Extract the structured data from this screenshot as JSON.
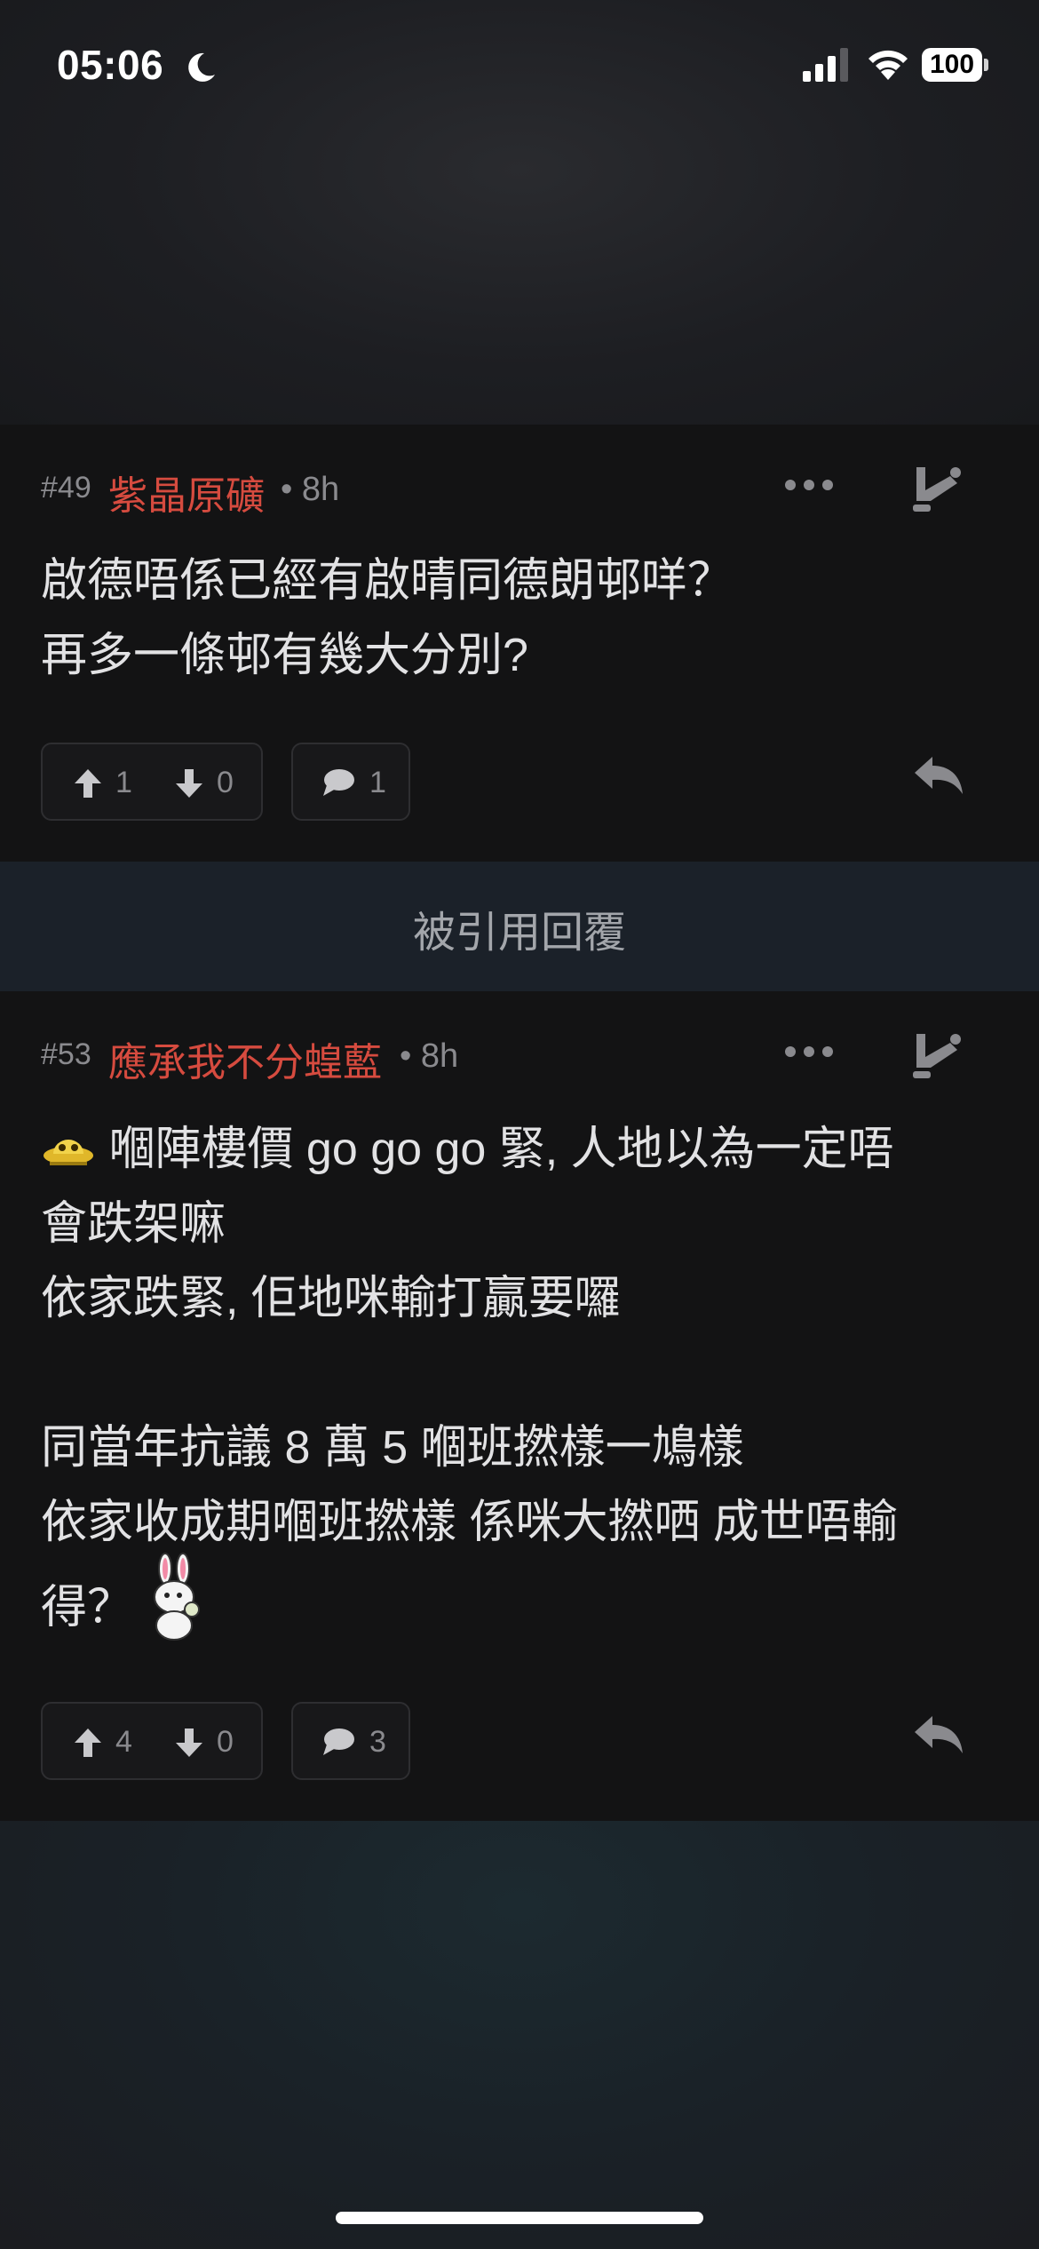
{
  "status_bar": {
    "time": "05:06",
    "battery": "100"
  },
  "posts": [
    {
      "number": "#49",
      "author": "紫晶原礦",
      "time": "• 8h",
      "lines": [
        "啟德唔係已經有啟晴同德朗邨咩？",
        "再多一條邨有幾大分別?"
      ],
      "upvotes": "1",
      "downvotes": "0",
      "comments": "1"
    },
    {
      "number": "#53",
      "author": "應承我不分蝗藍",
      "time": "• 8h",
      "lines": [
        "嗰陣樓價 go go go 緊, 人地以為一定唔",
        "會跌架嘛",
        "依家跌緊, 佢地咪輸打贏要囉",
        "",
        "同當年抗議 8 萬 5 嗰班撚樣一鳩樣",
        "依家收成期嗰班撚樣 係咪大撚哂 成世唔輸",
        "得？"
      ],
      "upvotes": "4",
      "downvotes": "0",
      "comments": "3"
    }
  ],
  "quoted_divider": {
    "label": "被引用回覆"
  },
  "colors": {
    "author": "#d64b3f",
    "card_bg": "#131314",
    "divider_bg": "#1b2129"
  },
  "icons": [
    "moon-icon",
    "signal-icon",
    "wifi-icon",
    "more-icon",
    "quote-jump-icon",
    "upvote-icon",
    "downvote-icon",
    "comment-icon",
    "reply-icon",
    "ufo-emoji",
    "rabbit-sticker"
  ]
}
